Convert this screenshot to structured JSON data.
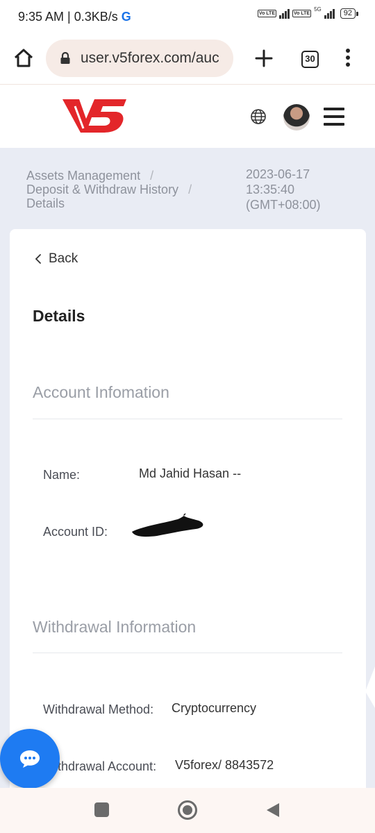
{
  "status_bar": {
    "time_text": "9:35 AM | 0.3KB/s",
    "g_letter": "G",
    "volte_1": "Vo LTE",
    "volte_2": "Vo LTE",
    "net_5g": "5G",
    "battery": "92"
  },
  "browser": {
    "url": "user.v5forex.com/auc",
    "tab_count": "30"
  },
  "site_header": {
    "logo_text": "V5",
    "brand_color": "#e3262a"
  },
  "breadcrumb": {
    "items": [
      "Assets Management",
      "Deposit & Withdraw History",
      "Details"
    ],
    "separator": "/"
  },
  "timestamp": {
    "date": "2023-06-17",
    "time": "13:35:40",
    "timezone": "(GMT+08:00)"
  },
  "card": {
    "back_label": "Back",
    "title": "Details",
    "account_section": {
      "title": "Account Infomation",
      "name_label": "Name:",
      "name_value": "Md Jahid Hasan --",
      "account_id_label": "Account ID:"
    },
    "withdrawal_section": {
      "title": "Withdrawal Information",
      "method_label": "Withdrawal Method:",
      "method_value": "Cryptocurrency",
      "account_label": "Withdrawal Account:",
      "account_value": "V5forex/ 8843572"
    }
  },
  "colors": {
    "accent_blue": "#1e7bf2",
    "page_gray": "#e9ecf4"
  }
}
